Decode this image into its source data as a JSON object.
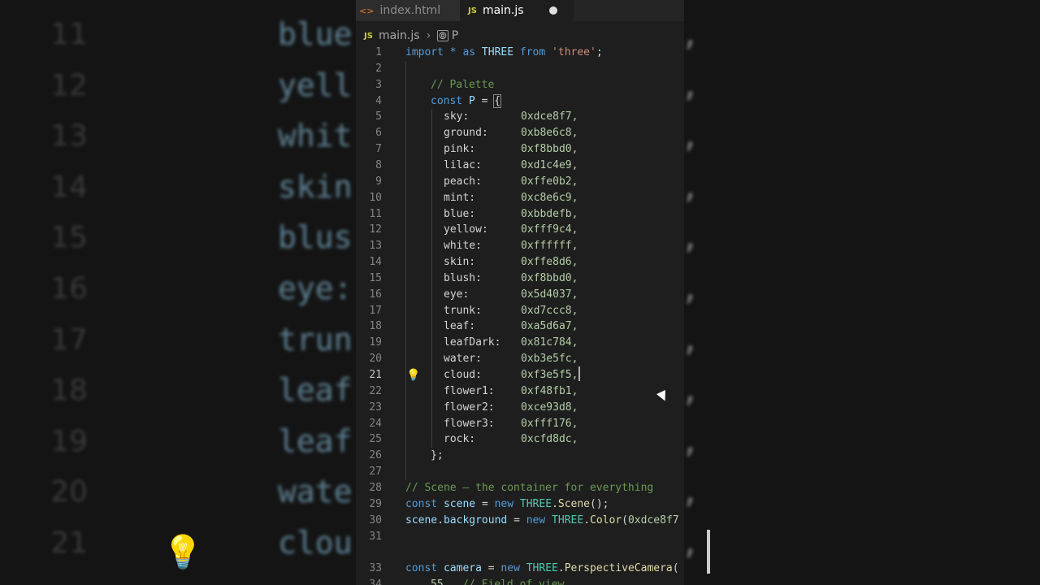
{
  "tabs": [
    {
      "label": "index.html",
      "icon": "html-file-icon",
      "active": false
    },
    {
      "label": "main.js",
      "icon": "js-file-icon",
      "active": true,
      "dirty": true
    }
  ],
  "breadcrumb": {
    "file": "main.js",
    "file_icon": "JS",
    "symbol": "P"
  },
  "file_icons": {
    "html": "<>",
    "js": "JS"
  },
  "active_line": 21,
  "code": {
    "l1": [
      "import",
      " * ",
      "as",
      " THREE ",
      "from",
      " 'three'",
      ";"
    ],
    "l3": "// Palette",
    "l4": [
      "const",
      " P ",
      "= ",
      "{"
    ],
    "palette": [
      {
        "key": "sky:",
        "value": "0xdce8f7,"
      },
      {
        "key": "ground:",
        "value": "0xb8e6c8,"
      },
      {
        "key": "pink:",
        "value": "0xf8bbd0,"
      },
      {
        "key": "lilac:",
        "value": "0xd1c4e9,"
      },
      {
        "key": "peach:",
        "value": "0xffe0b2,"
      },
      {
        "key": "mint:",
        "value": "0xc8e6c9,"
      },
      {
        "key": "blue:",
        "value": "0xbbdefb,"
      },
      {
        "key": "yellow:",
        "value": "0xfff9c4,"
      },
      {
        "key": "white:",
        "value": "0xffffff,"
      },
      {
        "key": "skin:",
        "value": "0xffe8d6,"
      },
      {
        "key": "blush:",
        "value": "0xf8bbd0,"
      },
      {
        "key": "eye:",
        "value": "0x5d4037,"
      },
      {
        "key": "trunk:",
        "value": "0xd7ccc8,"
      },
      {
        "key": "leaf:",
        "value": "0xa5d6a7,"
      },
      {
        "key": "leafDark:",
        "value": "0x81c784,"
      },
      {
        "key": "water:",
        "value": "0xb3e5fc,"
      },
      {
        "key": "cloud:",
        "value": "0xf3e5f5,"
      },
      {
        "key": "flower1:",
        "value": "0xf48fb1,"
      },
      {
        "key": "flower2:",
        "value": "0xce93d8,"
      },
      {
        "key": "flower3:",
        "value": "0xfff176,"
      },
      {
        "key": "rock:",
        "value": "0xcfd8dc,"
      }
    ],
    "l26": "};",
    "l28": "// Scene – the container for everything",
    "l29": [
      "const",
      " scene ",
      "= ",
      "new",
      " THREE",
      ".",
      "Scene",
      "();"
    ],
    "l30": [
      "scene",
      ".",
      "background",
      " = ",
      "new",
      " THREE",
      ".",
      "Color",
      "(",
      "0xdce8f7"
    ],
    "l33": [
      "const",
      " camera ",
      "= ",
      "new",
      " THREE",
      ".",
      "PerspectiveCamera",
      "("
    ],
    "l34": [
      "55",
      ",  ",
      "// Field of view"
    ]
  },
  "background_zoom": {
    "lines": [
      {
        "num": "11",
        "key": "blue"
      },
      {
        "num": "12",
        "key": "yell"
      },
      {
        "num": "13",
        "key": "whit"
      },
      {
        "num": "14",
        "key": "skin"
      },
      {
        "num": "15",
        "key": "blus"
      },
      {
        "num": "16",
        "key": "eye:"
      },
      {
        "num": "17",
        "key": "trun"
      },
      {
        "num": "18",
        "key": "leaf"
      },
      {
        "num": "19",
        "key": "leaf"
      },
      {
        "num": "20",
        "key": "wate"
      },
      {
        "num": "21",
        "key": "clou"
      }
    ],
    "comma": ","
  },
  "colors": {
    "editor_bg": "#1e1e1e",
    "keyword": "#569cd6",
    "string": "#ce9178",
    "comment": "#6a9955",
    "variable": "#9cdcfe",
    "number": "#b5cea8",
    "class": "#4ec9b0",
    "function": "#dcdcaa"
  }
}
